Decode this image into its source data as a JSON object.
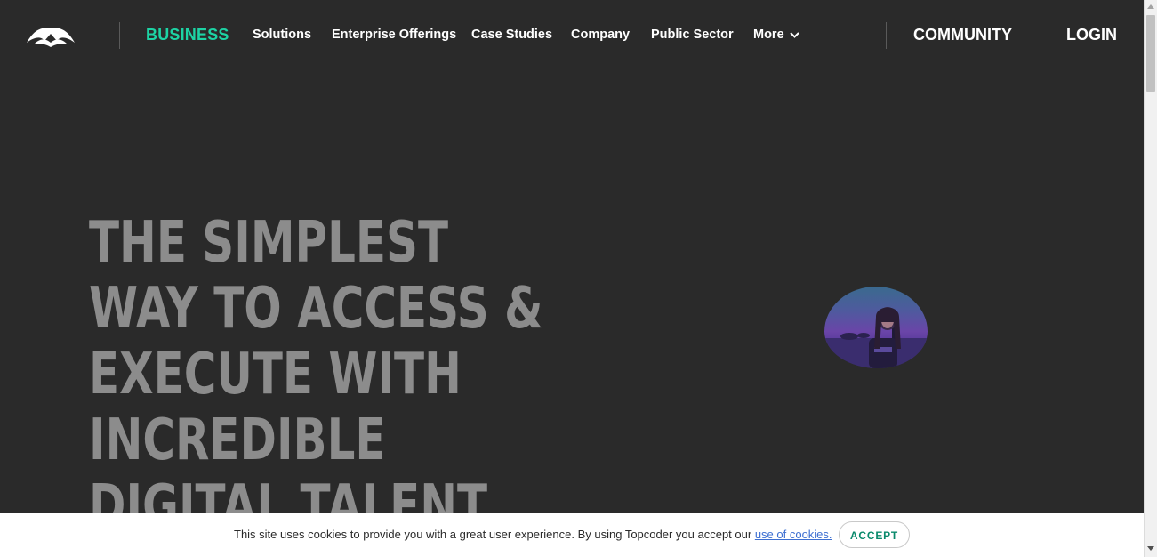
{
  "header": {
    "logo_icon": "topcoder-logo-icon",
    "business_label": "BUSINESS",
    "nav_items": [
      "Solutions",
      "Enterprise Offerings",
      "Case Studies",
      "Company",
      "Public Sector"
    ],
    "more_label": "More",
    "more_icon": "chevron-down-icon",
    "community_label": "COMMUNITY",
    "login_label": "LOGIN",
    "accent_color": "#1dd3a4"
  },
  "hero": {
    "title_lines": [
      "THE SIMPLEST",
      "WAY TO ACCESS &",
      "EXECUTE WITH",
      "INCREDIBLE",
      "DIGITAL TALENT"
    ]
  },
  "cookie": {
    "text": "This site uses cookies to provide you with a great user experience. By using Topcoder you accept our ",
    "link_text": "use of cookies.",
    "accept_label": "ACCEPT"
  }
}
